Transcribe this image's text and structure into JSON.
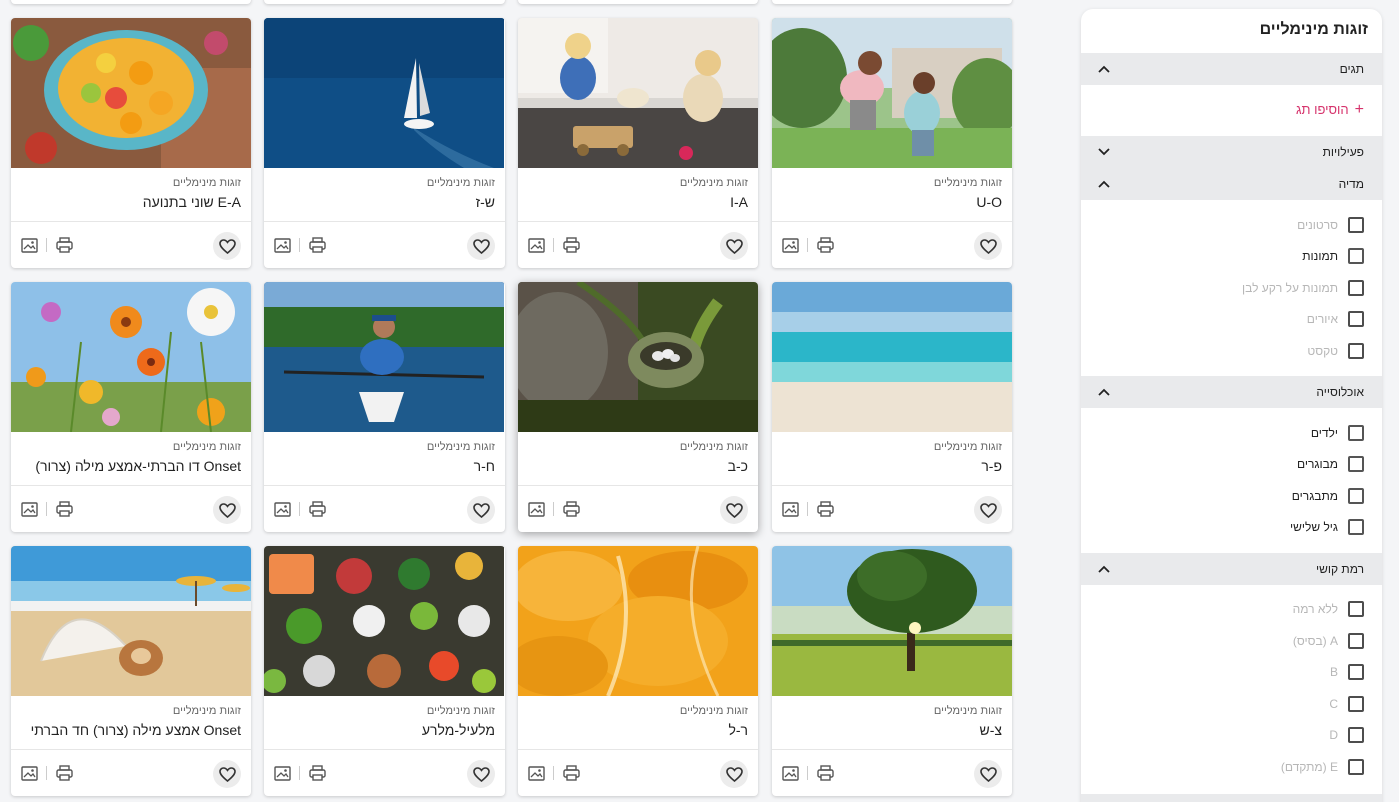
{
  "sidebar": {
    "title": "זוגות מינימליים",
    "sections": {
      "tags": {
        "label": "תגים",
        "add_tag": "הוסיפו תג"
      },
      "activities": {
        "label": "פעילויות"
      },
      "media": {
        "label": "מדיה",
        "options": [
          "סרטונים",
          "תמונות",
          "תמונות על רקע לבן",
          "איורים",
          "טקסט"
        ]
      },
      "population": {
        "label": "אוכלוסייה",
        "options": [
          "ילדים",
          "מבוגרים",
          "מתבגרים",
          "גיל שלישי"
        ]
      },
      "difficulty": {
        "label": "רמת קושי",
        "options": [
          "ללא רמה",
          "A (בסיס)",
          "B",
          "C",
          "D",
          "E (מתקדם)"
        ]
      }
    }
  },
  "cards": [
    {
      "category": "זוגות מינימליים",
      "title": "U-O",
      "image": "father-and-son-running-in-garden"
    },
    {
      "category": "זוגות מינימליים",
      "title": "I-A",
      "image": "two-toddlers-playing-with-toys"
    },
    {
      "category": "זוגות מינימליים",
      "title": "ש-ז",
      "image": "sailboat-on-blue-sea"
    },
    {
      "category": "זוגות מינימליים",
      "title": "E-A שוני בתנועה",
      "image": "fruit-bowl-on-table"
    },
    {
      "category": "זוגות מינימליים",
      "title": "פ-ר",
      "image": "tropical-beach"
    },
    {
      "category": "זוגות מינימליים",
      "title": "כ-ב",
      "image": "bird-nest-with-eggs"
    },
    {
      "category": "זוגות מינימליים",
      "title": "ח-ר",
      "image": "man-rowing-boat"
    },
    {
      "category": "זוגות מינימליים",
      "title": "Onset דו הברתי-אמצע מילה (צרור)",
      "image": "wild-flowers-and-sky"
    },
    {
      "category": "זוגות מינימליים",
      "title": "צ-ש",
      "image": "tree-in-sunny-field"
    },
    {
      "category": "זוגות מינימליים",
      "title": "ר-ל",
      "image": "orange-segments-closeup"
    },
    {
      "category": "זוגות מינימליים",
      "title": "מלעיל-מלרע",
      "image": "healthy-food-assortment"
    },
    {
      "category": "זוגות מינימליים",
      "title": "Onset אמצע מילה (צרור) חד הברתי",
      "image": "seashells-on-beach"
    }
  ]
}
